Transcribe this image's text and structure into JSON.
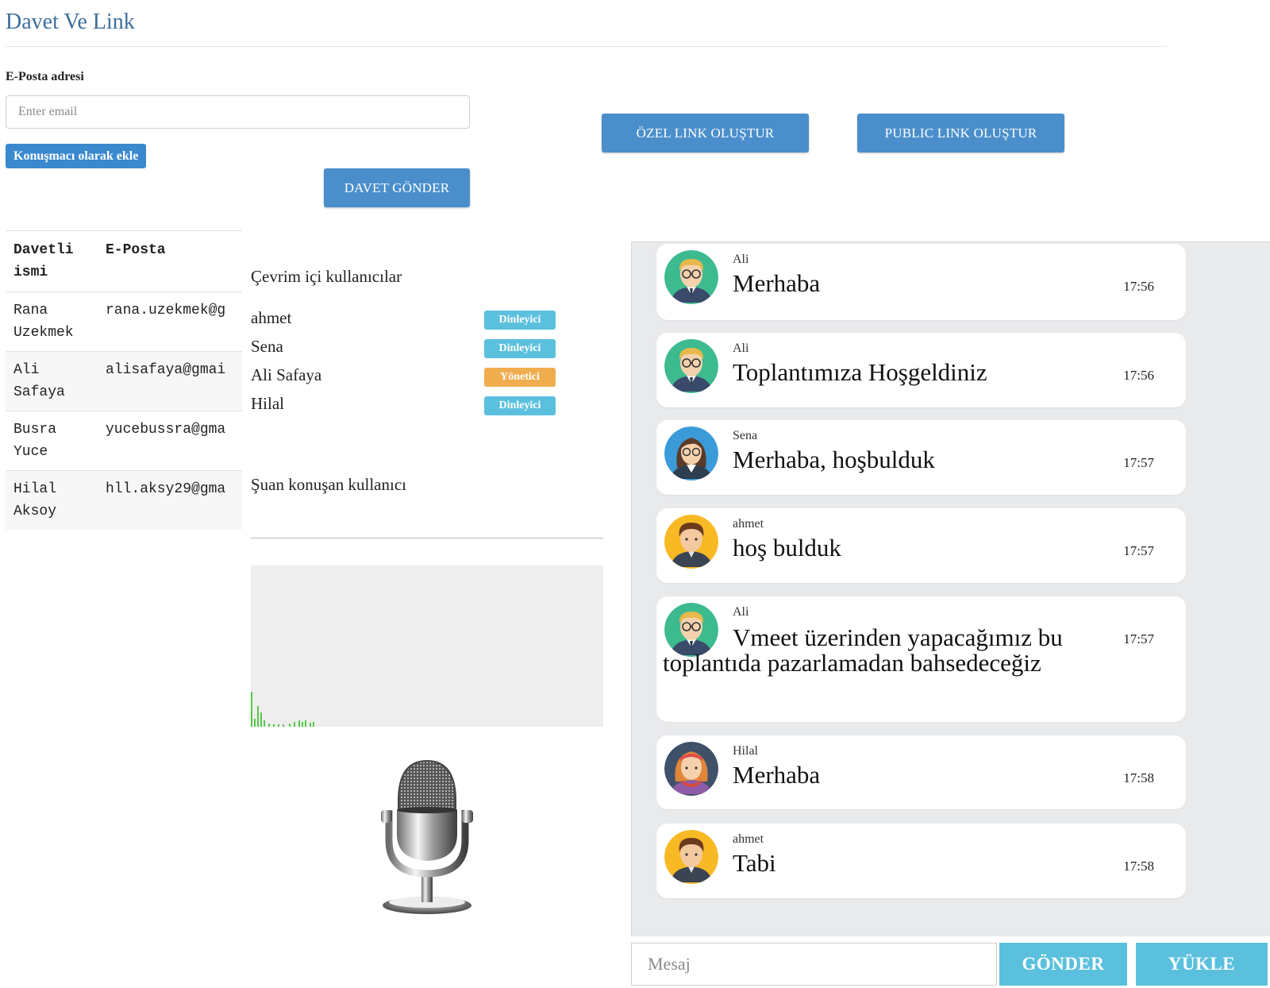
{
  "header": {
    "title": "Davet Ve Link"
  },
  "invite": {
    "email_label": "E-Posta adresi",
    "email_placeholder": "Enter email",
    "email_value": "",
    "add_speaker_label": "Konuşmacı olarak ekle",
    "send_invite_label": "DAVET GÖNDER",
    "private_link_label": "ÖZEL LINK OLUŞTUR",
    "public_link_label": "PUBLIC LINK OLUŞTUR"
  },
  "invitees": {
    "columns": [
      "Davetli ismi",
      "E-Posta"
    ],
    "rows": [
      {
        "name": "Rana Uzekmek",
        "email": "rana.uzekmek@g"
      },
      {
        "name": "Ali Safaya",
        "email": "alisafaya@gmai"
      },
      {
        "name": "Busra Yuce",
        "email": "yucebussra@gma"
      },
      {
        "name": "Hilal Aksoy",
        "email": "hll.aksy29@gma"
      }
    ]
  },
  "online": {
    "title": "Çevrim içi kullanıcılar",
    "users": [
      {
        "name": "ahmet",
        "role": "Dinleyici",
        "role_type": "listener"
      },
      {
        "name": "Sena",
        "role": "Dinleyici",
        "role_type": "listener"
      },
      {
        "name": "Ali Safaya",
        "role": "Yönetici",
        "role_type": "admin"
      },
      {
        "name": "Hilal",
        "role": "Dinleyici",
        "role_type": "listener"
      }
    ]
  },
  "speaking": {
    "title": "Şuan konuşan kullanıcı"
  },
  "chat": {
    "messages": [
      {
        "sender": "Ali",
        "text": "Merhaba",
        "time": "17:56",
        "avatar": "ali"
      },
      {
        "sender": "Ali",
        "text": "Toplantımıza Hoşgeldiniz",
        "time": "17:56",
        "avatar": "ali"
      },
      {
        "sender": "Sena",
        "text": "Merhaba, hoşbulduk",
        "time": "17:57",
        "avatar": "sena"
      },
      {
        "sender": "ahmet",
        "text": "hoş bulduk",
        "time": "17:57",
        "avatar": "ahmet"
      },
      {
        "sender": "Ali",
        "text": "Vmeet üzerinden yapacağımız bu toplantıda pazarlamadan bahsedeceğiz",
        "time": "17:57",
        "avatar": "ali"
      },
      {
        "sender": "Hilal",
        "text": "Merhaba",
        "time": "17:58",
        "avatar": "hilal"
      },
      {
        "sender": "ahmet",
        "text": "Tabi",
        "time": "17:58",
        "avatar": "ahmet"
      }
    ],
    "input_placeholder": "Mesaj",
    "input_value": "",
    "send_label": "GÖNDER",
    "upload_label": "YÜKLE"
  },
  "colors": {
    "title": "#3d6e9c",
    "primary_button": "#4a8fcb",
    "speaker_button": "#3a89cf",
    "listener_badge": "#5bc0de",
    "admin_badge": "#f0ad4e",
    "chat_background": "#e9eaec",
    "chat_button": "#5bc0de",
    "visualizer_bar": "#55c948"
  },
  "icons": {
    "microphone": "microphone-icon",
    "avatars": [
      "ali-avatar-icon",
      "sena-avatar-icon",
      "ahmet-avatar-icon",
      "hilal-avatar-icon"
    ]
  }
}
